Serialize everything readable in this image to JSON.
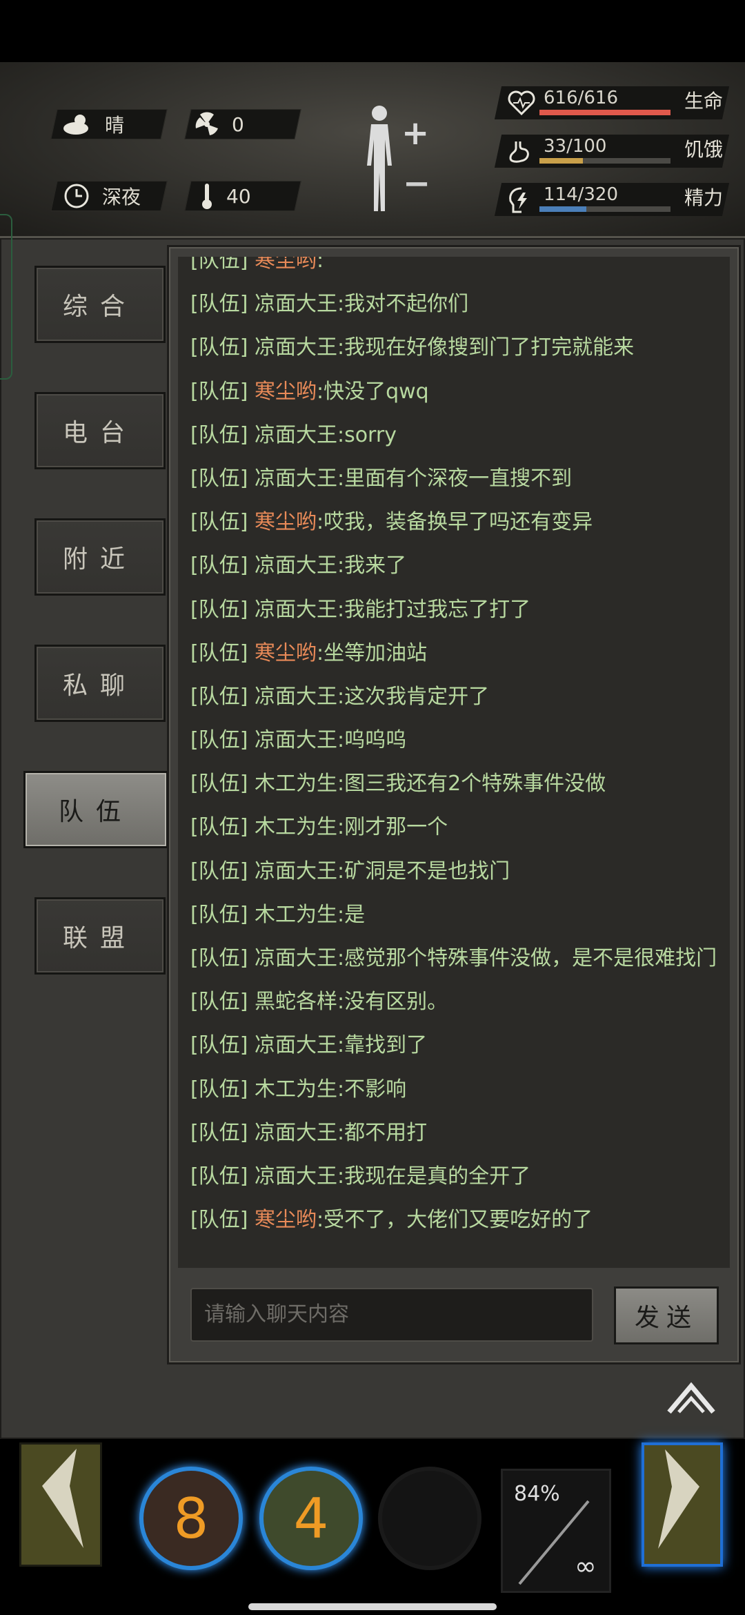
{
  "header": {
    "weather": "晴",
    "radiation": "0",
    "time_of_day": "深夜",
    "temperature": "40",
    "stats": [
      {
        "value": "616/616",
        "label": "生命",
        "fill": 1.0,
        "color": "#e0594c"
      },
      {
        "value": "33/100",
        "label": "饥饿",
        "fill": 0.33,
        "color": "#c9a04a"
      },
      {
        "value": "114/320",
        "label": "精力",
        "fill": 0.356,
        "color": "#4b7fb9"
      }
    ]
  },
  "tabs": [
    {
      "label": "综合",
      "active": false
    },
    {
      "label": "电台",
      "active": false
    },
    {
      "label": "附近",
      "active": false
    },
    {
      "label": "私聊",
      "active": false
    },
    {
      "label": "队伍",
      "active": true
    },
    {
      "label": "联盟",
      "active": false
    }
  ],
  "chat": {
    "messages": [
      {
        "channel": "[队伍]",
        "name": "寒尘哟",
        "text": ":",
        "orange": true
      },
      {
        "channel": "[队伍]",
        "name": "凉面大王",
        "text": ":我对不起你们",
        "orange": false
      },
      {
        "channel": "[队伍]",
        "name": "凉面大王",
        "text": ":我现在好像搜到门了打完就能来",
        "orange": false
      },
      {
        "channel": "[队伍]",
        "name": "寒尘哟",
        "text": ":快没了qwq",
        "orange": true
      },
      {
        "channel": "[队伍]",
        "name": "凉面大王",
        "text": ":sorry",
        "orange": false
      },
      {
        "channel": "[队伍]",
        "name": "凉面大王",
        "text": ":里面有个深夜一直搜不到",
        "orange": false
      },
      {
        "channel": "[队伍]",
        "name": "寒尘哟",
        "text": ":哎我，装备换早了吗还有变异",
        "orange": true
      },
      {
        "channel": "[队伍]",
        "name": "凉面大王",
        "text": ":我来了",
        "orange": false
      },
      {
        "channel": "[队伍]",
        "name": "凉面大王",
        "text": ":我能打过我忘了打了",
        "orange": false
      },
      {
        "channel": "[队伍]",
        "name": "寒尘哟",
        "text": ":坐等加油站",
        "orange": true
      },
      {
        "channel": "[队伍]",
        "name": "凉面大王",
        "text": ":这次我肯定开了",
        "orange": false
      },
      {
        "channel": "[队伍]",
        "name": "凉面大王",
        "text": ":呜呜呜",
        "orange": false
      },
      {
        "channel": "[队伍]",
        "name": "木工为生",
        "text": ":图三我还有2个特殊事件没做",
        "orange": false
      },
      {
        "channel": "[队伍]",
        "name": "木工为生",
        "text": ":刚才那一个",
        "orange": false
      },
      {
        "channel": "[队伍]",
        "name": "凉面大王",
        "text": ":矿洞是不是也找门",
        "orange": false
      },
      {
        "channel": "[队伍]",
        "name": "木工为生",
        "text": ":是",
        "orange": false
      },
      {
        "channel": "[队伍]",
        "name": "凉面大王",
        "text": ":感觉那个特殊事件没做，是不是很难找门",
        "orange": false
      },
      {
        "channel": "[队伍]",
        "name": "黑蛇各样",
        "text": ":没有区别。",
        "orange": false
      },
      {
        "channel": "[队伍]",
        "name": "凉面大王",
        "text": ":靠找到了",
        "orange": false
      },
      {
        "channel": "[队伍]",
        "name": "木工为生",
        "text": ":不影响",
        "orange": false
      },
      {
        "channel": "[队伍]",
        "name": "凉面大王",
        "text": ":都不用打",
        "orange": false
      },
      {
        "channel": "[队伍]",
        "name": "凉面大王",
        "text": ":我现在是真的全开了",
        "orange": false
      },
      {
        "channel": "[队伍]",
        "name": "寒尘哟",
        "text": ":受不了，大佬们又要吃好的了",
        "orange": true
      }
    ],
    "input_placeholder": "请输入聊天内容",
    "send_label": "发送"
  },
  "hotbar": {
    "slot1_count": "8",
    "slot2_count": "4",
    "weapon_durability": "84%",
    "weapon_ammo": "∞"
  }
}
